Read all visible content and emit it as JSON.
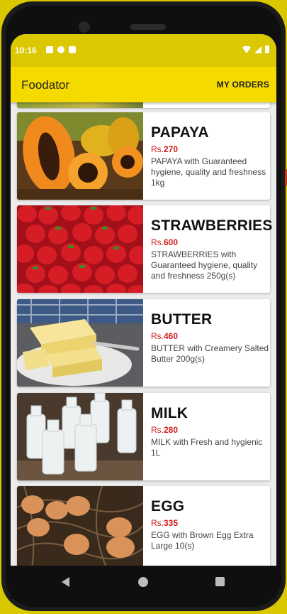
{
  "status_bar": {
    "time": "10:16"
  },
  "app_bar": {
    "title": "Foodator",
    "orders_label": "MY ORDERS"
  },
  "products": [
    {
      "name": "PAPAYA",
      "currency": "Rs.",
      "price": "270",
      "description": "PAPAYA with Guaranteed hygiene, quality and freshness 1kg"
    },
    {
      "name": "STRAWBERRIES",
      "currency": "Rs.",
      "price": "600",
      "description": "STRAWBERRIES with Guaranteed hygiene, quality and freshness 250g(s)"
    },
    {
      "name": "BUTTER",
      "currency": "Rs.",
      "price": "460",
      "description": "BUTTER with Creamery Salted Butter 200g(s)"
    },
    {
      "name": "MILK",
      "currency": "Rs.",
      "price": "280",
      "description": "MILK with Fresh and hygienic 1L"
    },
    {
      "name": "EGG",
      "currency": "Rs.",
      "price": "335",
      "description": "EGG with Brown Egg Extra Large 10(s)"
    }
  ],
  "colors": {
    "app_bar": "#f5da00",
    "status_bar": "#dcc800",
    "price": "#d11b1b"
  }
}
